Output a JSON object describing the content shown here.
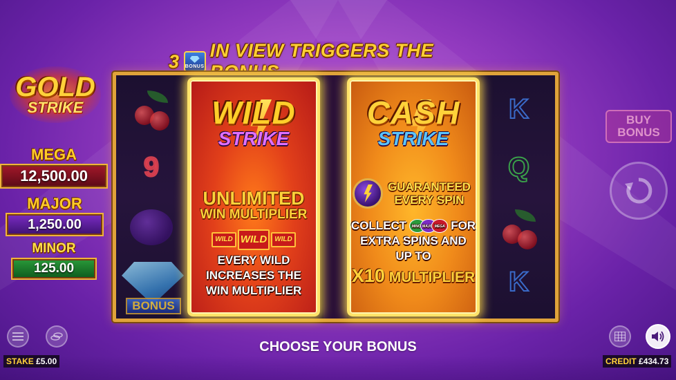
{
  "trigger_banner": {
    "count": "3",
    "icon_label": "BONUS",
    "text": "IN VIEW TRIGGERS THE BONUS"
  },
  "logo": {
    "line1": "GOLD",
    "line2": "STRIKE"
  },
  "jackpots": [
    {
      "label": "MEGA",
      "value": "12,500.00",
      "color": "#a3182a"
    },
    {
      "label": "MAJOR",
      "value": "1,250.00",
      "color": "#7b2cc4"
    },
    {
      "label": "MINOR",
      "value": "125.00",
      "color": "#2a9a3a"
    }
  ],
  "reels": {
    "left_symbols": [
      "cherry",
      "9",
      "plum",
      "diamond-bonus"
    ],
    "left_bonus_label": "BONUS",
    "right_symbols": [
      "K",
      "Q",
      "cherry",
      "K"
    ],
    "nine": "9",
    "k": "K",
    "q": "Q"
  },
  "options": {
    "wild": {
      "title_line1": "WILD",
      "title_line2": "STRIKE",
      "headline": "UNLIMITED",
      "headline_sub": "WIN MULTIPLIER",
      "tile_label": "WILD",
      "body": "EVERY WILD INCREASES THE WIN MULTIPLIER"
    },
    "cash": {
      "title_line1": "CASH",
      "title_line2": "STRIKE",
      "guarantee": "GUARANTEED EVERY SPIN",
      "collect_prefix": "COLLECT",
      "collect_suffix": "FOR",
      "coin_minor": "MINOR",
      "coin_major": "MAJOR",
      "coin_mega": "MEGA",
      "body": "EXTRA SPINS AND UP TO",
      "multiplier_x": "X10",
      "multiplier_label": "MULTIPLIER"
    }
  },
  "controls": {
    "buy_bonus_line1": "BUY",
    "buy_bonus_line2": "BONUS"
  },
  "footer": {
    "choose_label": "CHOOSE YOUR BONUS",
    "stake_label": "STAKE",
    "stake_value": "£5.00",
    "credit_label": "CREDIT",
    "credit_value": "£434.73"
  },
  "colors": {
    "background": "#9a3fc4",
    "gold": "#ffcf33",
    "frame": "#e0a33a"
  }
}
